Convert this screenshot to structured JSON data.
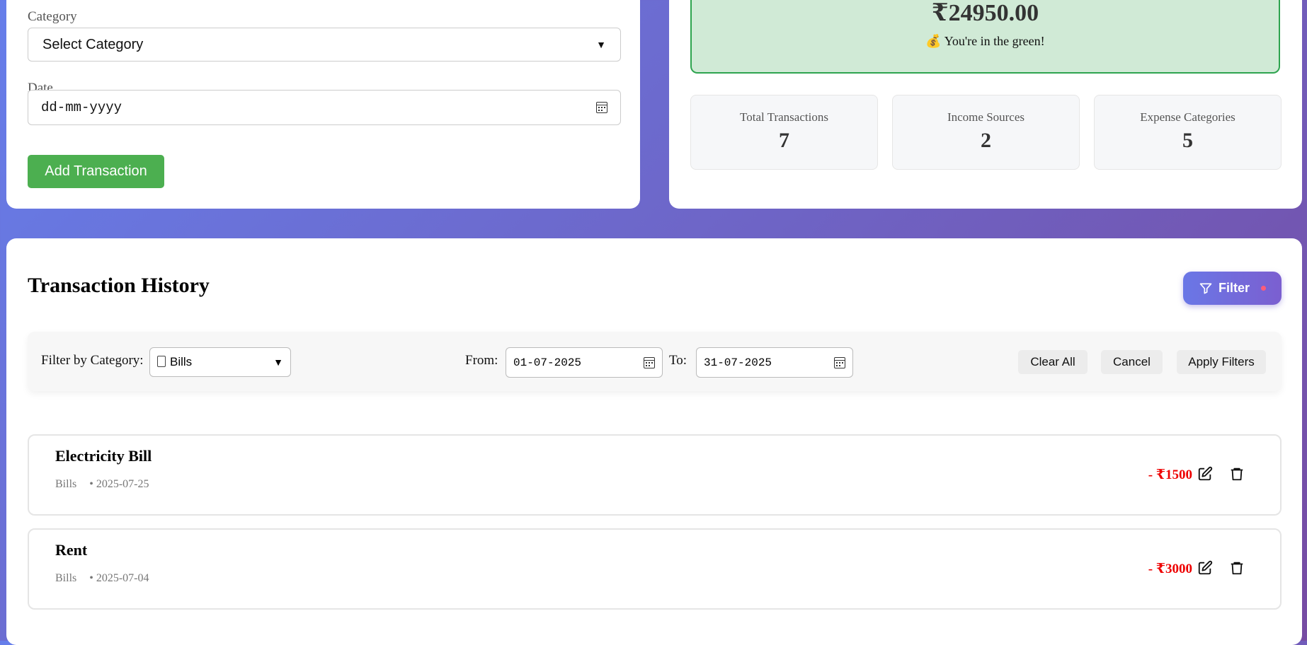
{
  "form": {
    "category_label": "Category",
    "category_value": "Select Category",
    "date_label": "Date",
    "date_placeholder": "dd-mm-yyyy",
    "add_button": "Add Transaction"
  },
  "summary": {
    "balance": "₹24950.00",
    "balance_message": "You're in the green!",
    "stats": [
      {
        "label": "Total Transactions",
        "value": "7"
      },
      {
        "label": "Income Sources",
        "value": "2"
      },
      {
        "label": "Expense Categories",
        "value": "5"
      }
    ]
  },
  "history": {
    "title": "Transaction History",
    "filter_button": "Filter",
    "filters": {
      "category_label": "Filter by Category:",
      "category_value": "Bills",
      "from_label": "From:",
      "from_value": "01-07-2025",
      "to_label": "To:",
      "to_value": "31-07-2025",
      "clear_all": "Clear All",
      "cancel": "Cancel",
      "apply": "Apply Filters"
    },
    "transactions": [
      {
        "name": "Electricity Bill",
        "category": "Bills",
        "date": "• 2025-07-25",
        "amount": "- ₹1500"
      },
      {
        "name": "Rent",
        "category": "Bills",
        "date": "• 2025-07-04",
        "amount": "- ₹3000"
      }
    ]
  },
  "colors": {
    "accent_green": "#4caf50",
    "expense_red": "#ee0000",
    "filter_gradient_start": "#6a77e6",
    "filter_gradient_end": "#7b5fd0"
  }
}
